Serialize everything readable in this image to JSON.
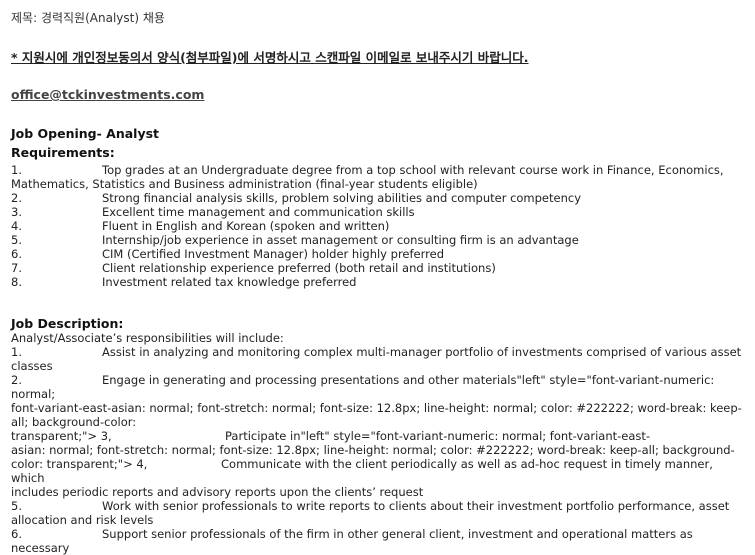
{
  "subject": "제목: 경력직원(Analyst)  채용",
  "notice": "* 지원시에 개인정보동의서 양식(첨부파일)에 서명하시고 스캔파일 이메일로 보내주시기 바랍니다.",
  "email": "office@tckinvestments.com",
  "job_opening": "Job Opening- Analyst",
  "requirements_heading": "Requirements:",
  "requirements": [
    {
      "num": "1.",
      "text": "Top grades at an Undergraduate degree from a top school with relevant course work in Finance, Economics,",
      "cont": "Mathematics, Statistics and Business administration (final-year students eligible)"
    },
    {
      "num": "2.",
      "text": "Strong financial analysis skills, problem solving abilities and computer competency"
    },
    {
      "num": "3.",
      "text": "Excellent time management and communication skills"
    },
    {
      "num": "4.",
      "text": "Fluent in English and Korean (spoken and written)"
    },
    {
      "num": "5.",
      "text": "Internship/job experience in asset management or consulting firm is an advantage"
    },
    {
      "num": "6.",
      "text": "CIM (Certified Investment Manager) holder highly preferred"
    },
    {
      "num": "7.",
      "text": "Client relationship experience preferred (both retail and institutions)"
    },
    {
      "num": "8.",
      "text": "Investment related tax knowledge preferred"
    }
  ],
  "description_heading": "Job Description:",
  "description_intro": "Analyst/Associate’s responsibilities will include:",
  "description": {
    "d1_num": "1.",
    "d1_text": "Assist in analyzing and monitoring complex multi-manager portfolio of investments comprised of various asset",
    "d1_cont": "classes",
    "d2_num": "2.",
    "d2_text": "Engage in generating and processing presentations and other materials\"left\" style=\"font-variant-numeric: normal;",
    "d2_cont1": "font-variant-east-asian: normal; font-stretch: normal; font-size: 12.8px; line-height: normal; color: #222222; word-break: keep-",
    "d2_cont2a": "all; background-color: transparent;\"> 3,",
    "d2_cont2b": "Participate in\"left\" style=\"font-variant-numeric: normal; font-variant-east-",
    "d2_cont3": "asian: normal; font-stretch: normal; font-size: 12.8px; line-height: normal; color: #222222; word-break: keep-all; background-",
    "d2_cont4a": "color: transparent;\"> 4,",
    "d2_cont4b": "Communicate with the client periodically as well as ad-hoc request in timely manner, which",
    "d2_cont5": "includes periodic reports and advisory reports upon the clients’ request",
    "d5_num": "5.",
    "d5_text": "Work with senior professionals to write reports to clients about their investment portfolio performance, asset",
    "d5_cont": "allocation and risk levels",
    "d6_num": "6.",
    "d6_text": "Support senior professionals of the firm in other general client, investment and operational matters as necessary"
  }
}
